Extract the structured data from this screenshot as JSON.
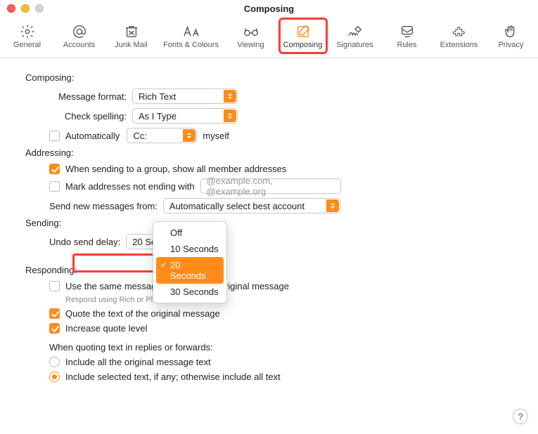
{
  "window": {
    "title": "Composing"
  },
  "toolbar": [
    {
      "id": "general",
      "label": "General"
    },
    {
      "id": "accounts",
      "label": "Accounts"
    },
    {
      "id": "junkmail",
      "label": "Junk Mail"
    },
    {
      "id": "fonts",
      "label": "Fonts & Colours"
    },
    {
      "id": "viewing",
      "label": "Viewing"
    },
    {
      "id": "composing",
      "label": "Composing",
      "active": true
    },
    {
      "id": "signatures",
      "label": "Signatures"
    },
    {
      "id": "rules",
      "label": "Rules"
    },
    {
      "id": "extensions",
      "label": "Extensions"
    },
    {
      "id": "privacy",
      "label": "Privacy"
    }
  ],
  "sections": {
    "composing": "Composing:",
    "addressing": "Addressing:",
    "sending": "Sending:",
    "responding": "Responding:"
  },
  "composing": {
    "messageFormatLabel": "Message format:",
    "messageFormatValue": "Rich Text",
    "checkSpellingLabel": "Check spelling:",
    "checkSpellingValue": "As I Type",
    "automatically": "Automatically",
    "ccValue": "Cc:",
    "myself": "myself"
  },
  "addressing": {
    "groupShow": "When sending to a group, show all member addresses",
    "markNotEnding": "Mark addresses not ending with",
    "markPlaceholder": "@example.com, @example.org",
    "sendFromLabel": "Send new messages from:",
    "sendFromValue": "Automatically select best account"
  },
  "sending": {
    "undoDelayLabel": "Undo send delay:",
    "menu": [
      "Off",
      "10 Seconds",
      "20 Seconds",
      "30 Seconds"
    ],
    "selected": "20 Seconds"
  },
  "responding": {
    "sameFormat": "Use the same message format as the original message",
    "sameFormatHint": "Respond using Rich or Plain Text",
    "quoteText": "Quote the text of the original message",
    "increaseQuote": "Increase quote level",
    "whenQuoting": "When quoting text in replies or forwards:",
    "includeAll": "Include all the original message text",
    "includeSelected": "Include selected text, if any; otherwise include all text"
  },
  "help": "?"
}
